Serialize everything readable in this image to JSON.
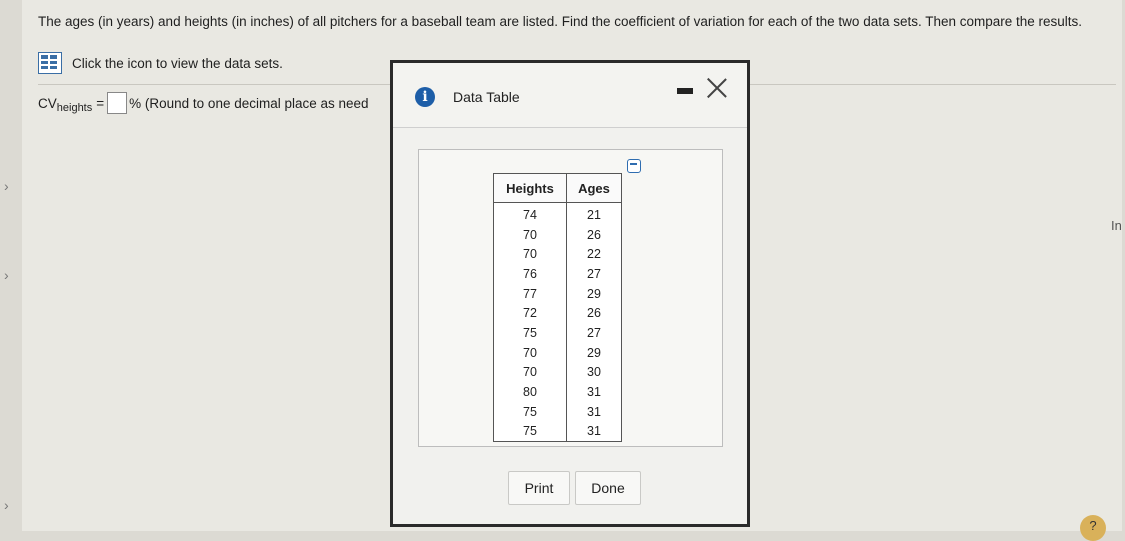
{
  "question": {
    "text": "The ages (in years) and heights (in inches) of all pitchers for a baseball team are listed. Find the coefficient of variation for each of the two data sets. Then compare the results."
  },
  "hint": {
    "text": "Click the icon to view the data sets.",
    "icon": "data-table-icon"
  },
  "cv": {
    "prefix": "CV",
    "subscript": "heights",
    "equals": "=",
    "suffix": "% (Round to one decimal place as need",
    "value": ""
  },
  "right_cut_text": "In",
  "help_text": "?",
  "dialog": {
    "title": "Data Table",
    "info_icon": "i",
    "table": {
      "headers": [
        "Heights",
        "Ages"
      ],
      "rows": [
        [
          "74",
          "21"
        ],
        [
          "70",
          "26"
        ],
        [
          "70",
          "22"
        ],
        [
          "76",
          "27"
        ],
        [
          "77",
          "29"
        ],
        [
          "72",
          "26"
        ],
        [
          "75",
          "27"
        ],
        [
          "70",
          "29"
        ],
        [
          "70",
          "30"
        ],
        [
          "80",
          "31"
        ],
        [
          "75",
          "31"
        ],
        [
          "75",
          "31"
        ]
      ]
    },
    "buttons": {
      "print": "Print",
      "done": "Done"
    }
  },
  "colors": {
    "accent": "#1d5ea8",
    "page_bg": "#e9e8e2",
    "dialog_border": "#2a2a2a"
  }
}
